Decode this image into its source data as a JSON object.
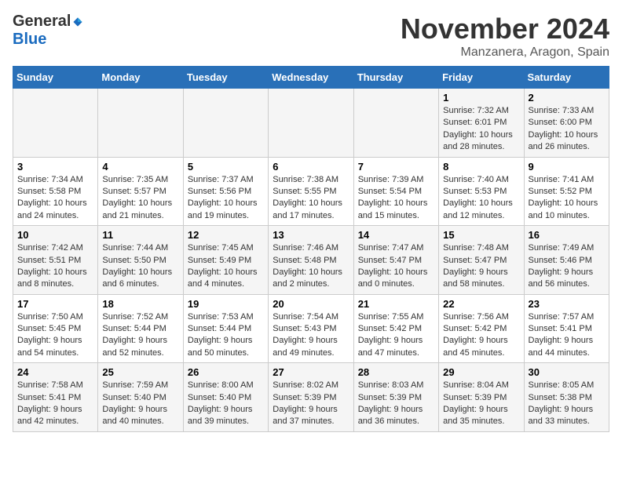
{
  "logo": {
    "general": "General",
    "blue": "Blue"
  },
  "title": "November 2024",
  "location": "Manzanera, Aragon, Spain",
  "days_of_week": [
    "Sunday",
    "Monday",
    "Tuesday",
    "Wednesday",
    "Thursday",
    "Friday",
    "Saturday"
  ],
  "weeks": [
    [
      {
        "day": "",
        "info": ""
      },
      {
        "day": "",
        "info": ""
      },
      {
        "day": "",
        "info": ""
      },
      {
        "day": "",
        "info": ""
      },
      {
        "day": "",
        "info": ""
      },
      {
        "day": "1",
        "info": "Sunrise: 7:32 AM\nSunset: 6:01 PM\nDaylight: 10 hours and 28 minutes."
      },
      {
        "day": "2",
        "info": "Sunrise: 7:33 AM\nSunset: 6:00 PM\nDaylight: 10 hours and 26 minutes."
      }
    ],
    [
      {
        "day": "3",
        "info": "Sunrise: 7:34 AM\nSunset: 5:58 PM\nDaylight: 10 hours and 24 minutes."
      },
      {
        "day": "4",
        "info": "Sunrise: 7:35 AM\nSunset: 5:57 PM\nDaylight: 10 hours and 21 minutes."
      },
      {
        "day": "5",
        "info": "Sunrise: 7:37 AM\nSunset: 5:56 PM\nDaylight: 10 hours and 19 minutes."
      },
      {
        "day": "6",
        "info": "Sunrise: 7:38 AM\nSunset: 5:55 PM\nDaylight: 10 hours and 17 minutes."
      },
      {
        "day": "7",
        "info": "Sunrise: 7:39 AM\nSunset: 5:54 PM\nDaylight: 10 hours and 15 minutes."
      },
      {
        "day": "8",
        "info": "Sunrise: 7:40 AM\nSunset: 5:53 PM\nDaylight: 10 hours and 12 minutes."
      },
      {
        "day": "9",
        "info": "Sunrise: 7:41 AM\nSunset: 5:52 PM\nDaylight: 10 hours and 10 minutes."
      }
    ],
    [
      {
        "day": "10",
        "info": "Sunrise: 7:42 AM\nSunset: 5:51 PM\nDaylight: 10 hours and 8 minutes."
      },
      {
        "day": "11",
        "info": "Sunrise: 7:44 AM\nSunset: 5:50 PM\nDaylight: 10 hours and 6 minutes."
      },
      {
        "day": "12",
        "info": "Sunrise: 7:45 AM\nSunset: 5:49 PM\nDaylight: 10 hours and 4 minutes."
      },
      {
        "day": "13",
        "info": "Sunrise: 7:46 AM\nSunset: 5:48 PM\nDaylight: 10 hours and 2 minutes."
      },
      {
        "day": "14",
        "info": "Sunrise: 7:47 AM\nSunset: 5:47 PM\nDaylight: 10 hours and 0 minutes."
      },
      {
        "day": "15",
        "info": "Sunrise: 7:48 AM\nSunset: 5:47 PM\nDaylight: 9 hours and 58 minutes."
      },
      {
        "day": "16",
        "info": "Sunrise: 7:49 AM\nSunset: 5:46 PM\nDaylight: 9 hours and 56 minutes."
      }
    ],
    [
      {
        "day": "17",
        "info": "Sunrise: 7:50 AM\nSunset: 5:45 PM\nDaylight: 9 hours and 54 minutes."
      },
      {
        "day": "18",
        "info": "Sunrise: 7:52 AM\nSunset: 5:44 PM\nDaylight: 9 hours and 52 minutes."
      },
      {
        "day": "19",
        "info": "Sunrise: 7:53 AM\nSunset: 5:44 PM\nDaylight: 9 hours and 50 minutes."
      },
      {
        "day": "20",
        "info": "Sunrise: 7:54 AM\nSunset: 5:43 PM\nDaylight: 9 hours and 49 minutes."
      },
      {
        "day": "21",
        "info": "Sunrise: 7:55 AM\nSunset: 5:42 PM\nDaylight: 9 hours and 47 minutes."
      },
      {
        "day": "22",
        "info": "Sunrise: 7:56 AM\nSunset: 5:42 PM\nDaylight: 9 hours and 45 minutes."
      },
      {
        "day": "23",
        "info": "Sunrise: 7:57 AM\nSunset: 5:41 PM\nDaylight: 9 hours and 44 minutes."
      }
    ],
    [
      {
        "day": "24",
        "info": "Sunrise: 7:58 AM\nSunset: 5:41 PM\nDaylight: 9 hours and 42 minutes."
      },
      {
        "day": "25",
        "info": "Sunrise: 7:59 AM\nSunset: 5:40 PM\nDaylight: 9 hours and 40 minutes."
      },
      {
        "day": "26",
        "info": "Sunrise: 8:00 AM\nSunset: 5:40 PM\nDaylight: 9 hours and 39 minutes."
      },
      {
        "day": "27",
        "info": "Sunrise: 8:02 AM\nSunset: 5:39 PM\nDaylight: 9 hours and 37 minutes."
      },
      {
        "day": "28",
        "info": "Sunrise: 8:03 AM\nSunset: 5:39 PM\nDaylight: 9 hours and 36 minutes."
      },
      {
        "day": "29",
        "info": "Sunrise: 8:04 AM\nSunset: 5:39 PM\nDaylight: 9 hours and 35 minutes."
      },
      {
        "day": "30",
        "info": "Sunrise: 8:05 AM\nSunset: 5:38 PM\nDaylight: 9 hours and 33 minutes."
      }
    ]
  ]
}
